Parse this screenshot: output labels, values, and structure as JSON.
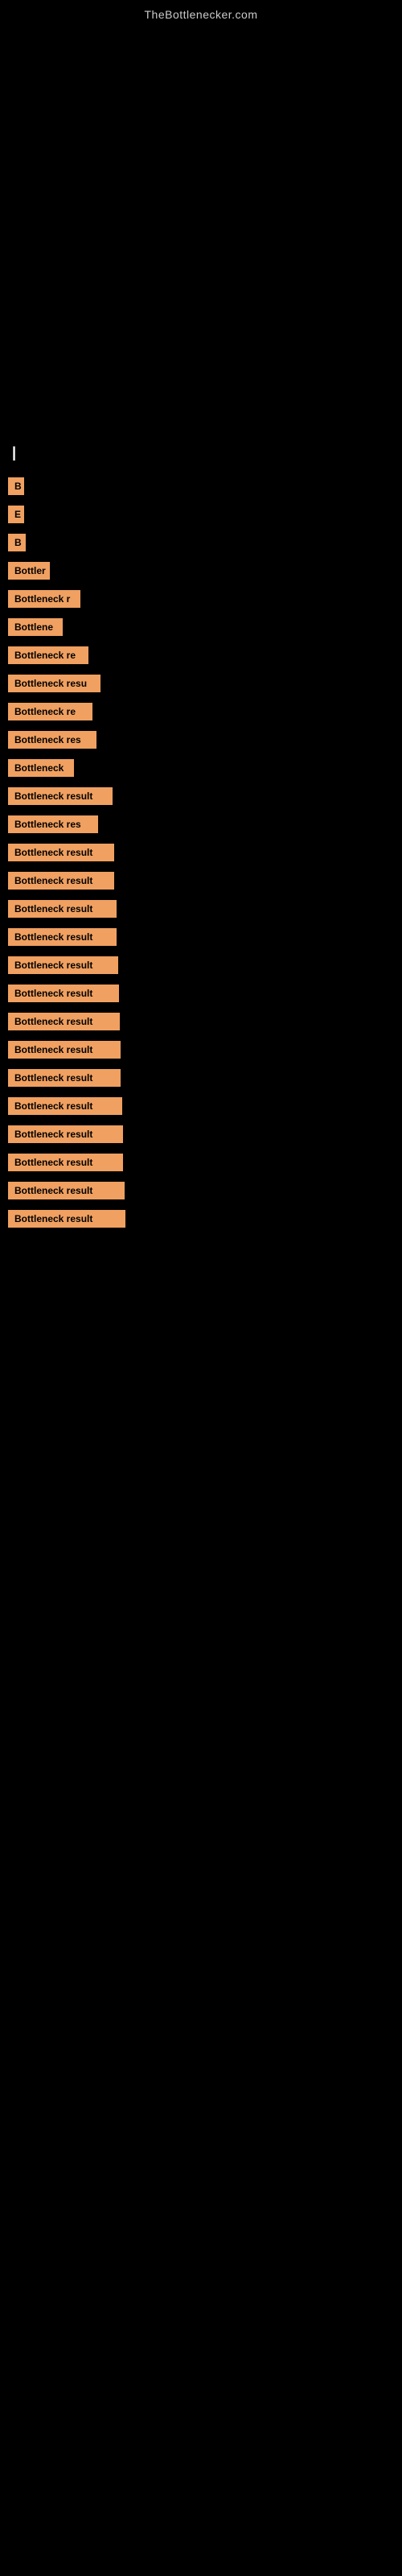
{
  "site": {
    "title": "TheBottlenecker.com"
  },
  "section": {
    "label": "|"
  },
  "results": [
    {
      "id": 1,
      "text": "B",
      "width": 20
    },
    {
      "id": 2,
      "text": "E",
      "width": 20
    },
    {
      "id": 3,
      "text": "B",
      "width": 22
    },
    {
      "id": 4,
      "text": "Bottler",
      "width": 52
    },
    {
      "id": 5,
      "text": "Bottleneck r",
      "width": 90
    },
    {
      "id": 6,
      "text": "Bottlene",
      "width": 68
    },
    {
      "id": 7,
      "text": "Bottleneck re",
      "width": 100
    },
    {
      "id": 8,
      "text": "Bottleneck resu",
      "width": 115
    },
    {
      "id": 9,
      "text": "Bottleneck re",
      "width": 105
    },
    {
      "id": 10,
      "text": "Bottleneck res",
      "width": 110
    },
    {
      "id": 11,
      "text": "Bottleneck",
      "width": 82
    },
    {
      "id": 12,
      "text": "Bottleneck result",
      "width": 130
    },
    {
      "id": 13,
      "text": "Bottleneck res",
      "width": 112
    },
    {
      "id": 14,
      "text": "Bottleneck result",
      "width": 132
    },
    {
      "id": 15,
      "text": "Bottleneck result",
      "width": 132
    },
    {
      "id": 16,
      "text": "Bottleneck result",
      "width": 135
    },
    {
      "id": 17,
      "text": "Bottleneck result",
      "width": 135
    },
    {
      "id": 18,
      "text": "Bottleneck result",
      "width": 137
    },
    {
      "id": 19,
      "text": "Bottleneck result",
      "width": 138
    },
    {
      "id": 20,
      "text": "Bottleneck result",
      "width": 139
    },
    {
      "id": 21,
      "text": "Bottleneck result",
      "width": 140
    },
    {
      "id": 22,
      "text": "Bottleneck result",
      "width": 140
    },
    {
      "id": 23,
      "text": "Bottleneck result",
      "width": 142
    },
    {
      "id": 24,
      "text": "Bottleneck result",
      "width": 143
    },
    {
      "id": 25,
      "text": "Bottleneck result",
      "width": 143
    },
    {
      "id": 26,
      "text": "Bottleneck result",
      "width": 145
    },
    {
      "id": 27,
      "text": "Bottleneck result",
      "width": 146
    }
  ]
}
